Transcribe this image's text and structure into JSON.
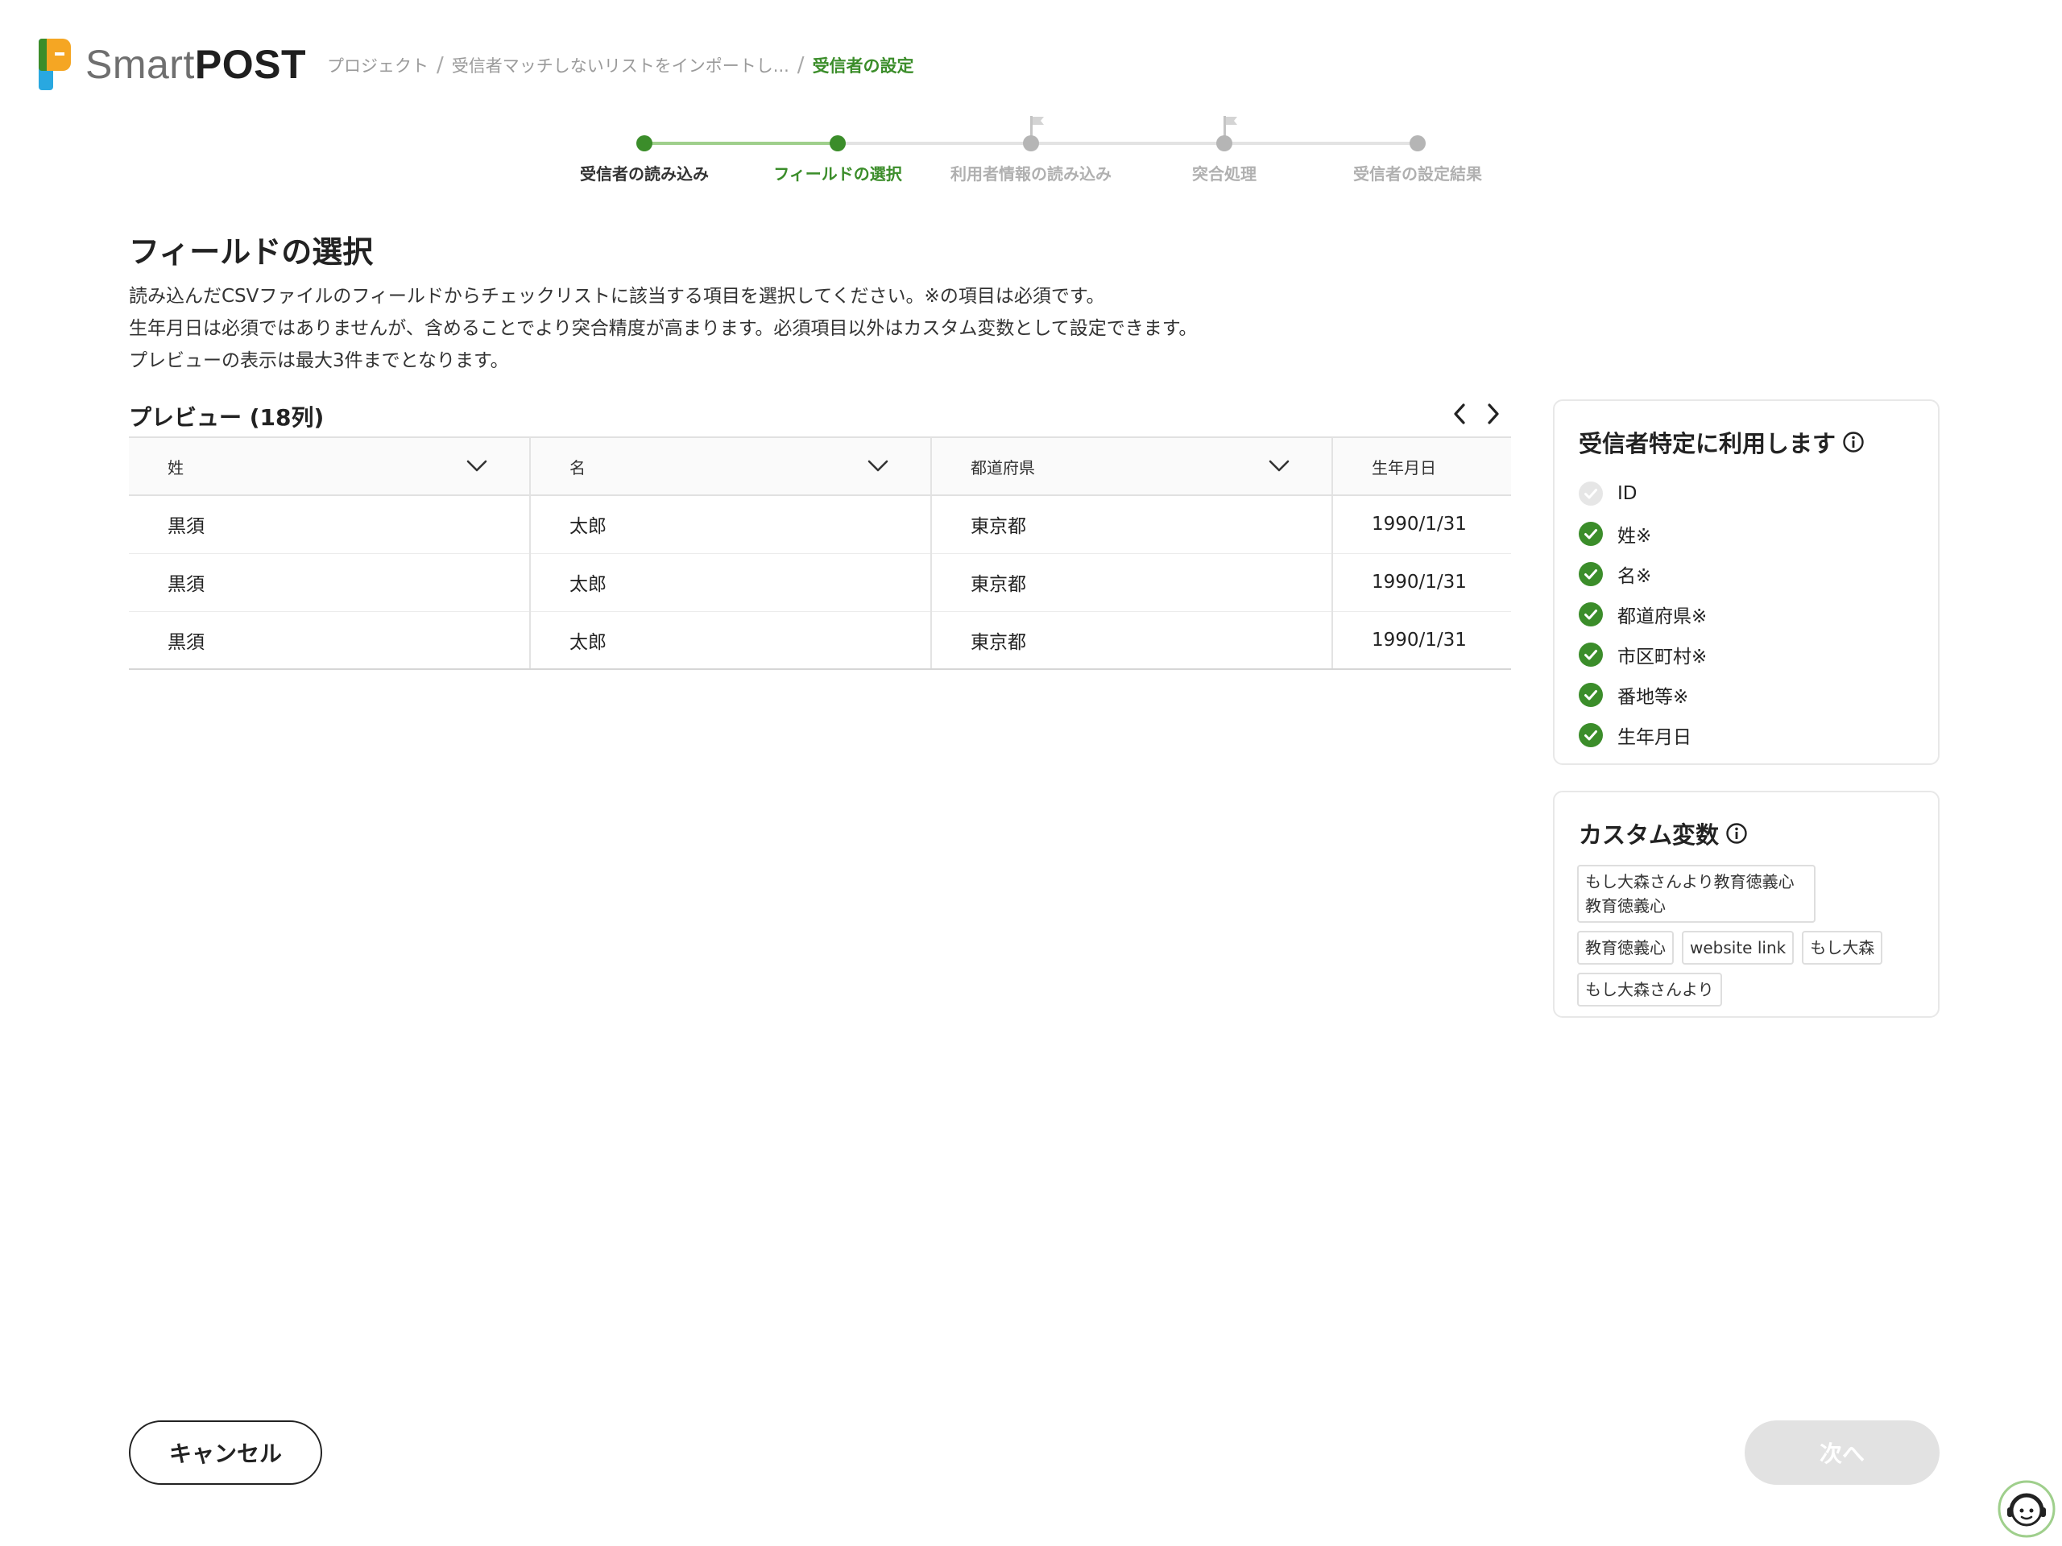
{
  "app": {
    "logo_smart": "Smart",
    "logo_post": "POST"
  },
  "breadcrumb": {
    "items": [
      "プロジェクト",
      "受信者マッチしないリストをインポートし...",
      "受信者の設定"
    ],
    "separator": "/"
  },
  "stepper": {
    "steps": [
      {
        "label": "受信者の読み込み",
        "state": "done"
      },
      {
        "label": "フィールドの選択",
        "state": "active"
      },
      {
        "label": "利用者情報の読み込み",
        "state": "pending",
        "flag": true
      },
      {
        "label": "突合処理",
        "state": "pending",
        "flag": true
      },
      {
        "label": "受信者の設定結果",
        "state": "pending"
      }
    ]
  },
  "page": {
    "title": "フィールドの選択",
    "description": [
      "読み込んだCSVファイルのフィールドからチェックリストに該当する項目を選択してください。※の項目は必須です。",
      "生年月日は必須ではありませんが、含めることでより突合精度が高まります。必須項目以外はカスタム変数として設定できます。",
      "プレビューの表示は最大3件までとなります。"
    ]
  },
  "preview": {
    "title": "プレビュー (18列)",
    "columns": [
      "姓",
      "名",
      "都道府県",
      "生年月日"
    ],
    "rows": [
      [
        "黒須",
        "太郎",
        "東京都",
        "1990/1/31"
      ],
      [
        "黒須",
        "太郎",
        "東京都",
        "1990/1/31"
      ],
      [
        "黒須",
        "太郎",
        "東京都",
        "1990/1/31"
      ]
    ]
  },
  "identification": {
    "title": "受信者特定に利用します",
    "items": [
      {
        "label": "ID",
        "checked": false
      },
      {
        "label": "姓※",
        "checked": true
      },
      {
        "label": "名※",
        "checked": true
      },
      {
        "label": "都道府県※",
        "checked": true
      },
      {
        "label": "市区町村※",
        "checked": true
      },
      {
        "label": "番地等※",
        "checked": true
      },
      {
        "label": "生年月日",
        "checked": true
      }
    ]
  },
  "custom": {
    "title": "カスタム変数",
    "chips": [
      "もし大森さんより教育徳義心教育徳義心",
      "教育徳義心",
      "website link",
      "もし大森",
      "もし大森さんより"
    ]
  },
  "buttons": {
    "cancel": "キャンセル",
    "next": "次へ"
  },
  "colors": {
    "accent": "#3b8d2a",
    "accent_light": "#9fcf8c",
    "disabled": "#e2e2e2",
    "logo_orange": "#f5a623",
    "logo_green": "#3b8d2a",
    "logo_blue": "#29a8e0"
  },
  "icons": {
    "logo": "smartpost-logo-icon",
    "pager_prev": "chevron-left-icon",
    "pager_next": "chevron-right-icon",
    "column_select": "chevron-down-icon",
    "info": "info-icon",
    "checked": "check-circle-icon",
    "support": "support-agent-icon",
    "flag": "flag-icon"
  }
}
